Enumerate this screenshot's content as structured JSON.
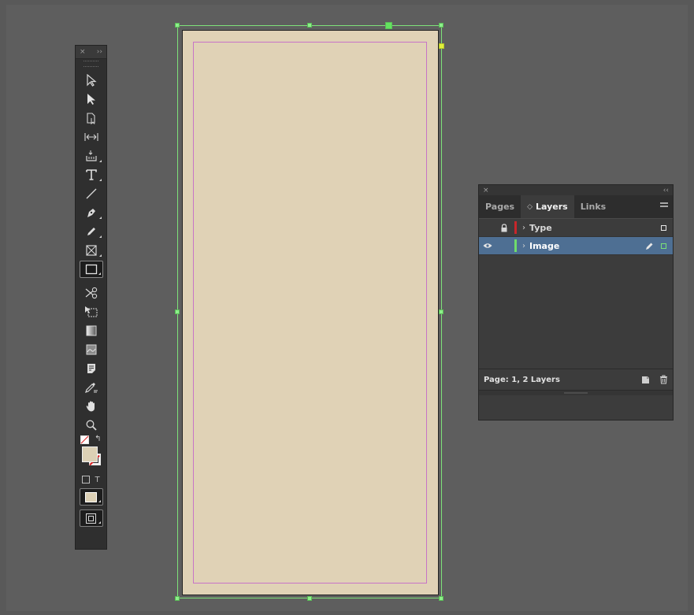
{
  "tools_panel": {
    "close_glyph": "×",
    "collapse_glyph": "››",
    "tools": [
      {
        "name": "selection-tool-icon"
      },
      {
        "name": "direct-selection-tool-icon"
      },
      {
        "name": "page-tool-icon"
      },
      {
        "name": "gap-tool-icon"
      },
      {
        "name": "content-collector-tool-icon"
      },
      {
        "name": "type-tool-icon"
      },
      {
        "name": "line-tool-icon"
      },
      {
        "name": "pen-tool-icon"
      },
      {
        "name": "pencil-tool-icon"
      },
      {
        "name": "rectangle-frame-tool-icon"
      },
      {
        "name": "rectangle-tool-icon",
        "selected": true
      },
      {
        "name": "scissors-tool-icon"
      },
      {
        "name": "free-transform-tool-icon"
      },
      {
        "name": "gradient-swatch-tool-icon"
      },
      {
        "name": "gradient-feather-tool-icon"
      },
      {
        "name": "note-tool-icon"
      },
      {
        "name": "eyedropper-tool-icon"
      },
      {
        "name": "hand-tool-icon"
      },
      {
        "name": "zoom-tool-icon"
      }
    ],
    "fill_color": "#dcd0b5",
    "formatting_text_glyph": "T"
  },
  "document": {
    "page_color": "#e0d2b6",
    "frame_color": "#7ee27a",
    "margin_color": "#c774c7"
  },
  "layers_panel": {
    "close_glyph": "×",
    "collapse_glyph": "‹‹",
    "tabs": [
      {
        "label": "Pages",
        "active": false
      },
      {
        "label": "Layers",
        "active": true
      },
      {
        "label": "Links",
        "active": false
      }
    ],
    "tab_sort_glyph": "◇",
    "layers": [
      {
        "name": "Type",
        "visible": false,
        "locked": true,
        "color": "#c8262a",
        "selected": false
      },
      {
        "name": "Image",
        "visible": true,
        "locked": false,
        "color": "#6fdc6b",
        "selected": true
      }
    ],
    "status": "Page: 1, 2 Layers"
  }
}
